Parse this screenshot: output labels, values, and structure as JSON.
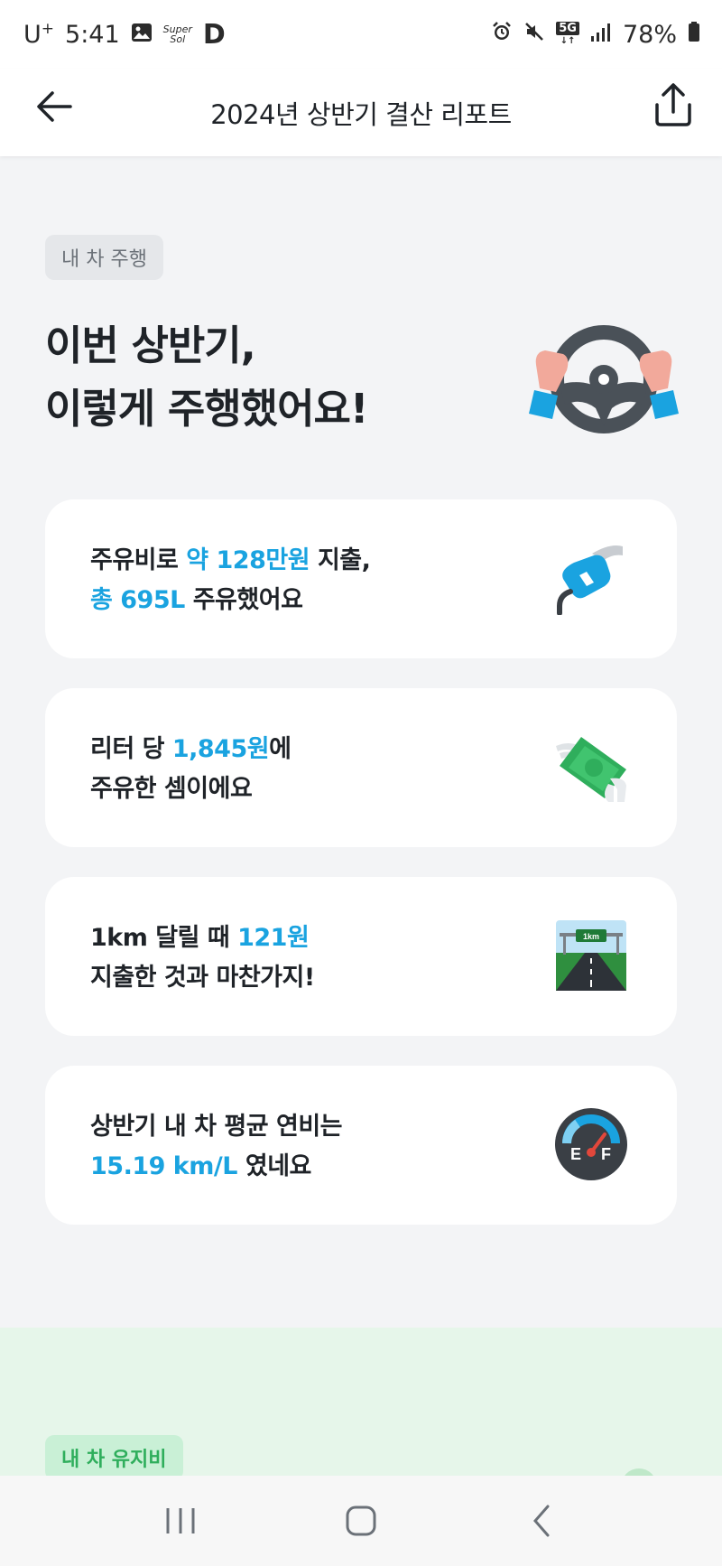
{
  "status_bar": {
    "carrier": "U",
    "carrier_sup": "+",
    "time": "5:41",
    "app_badge_top": "Super",
    "app_badge_bottom": "Sol",
    "app_letter": "D",
    "network": "5G",
    "battery": "78%"
  },
  "header": {
    "title": "2024년 상반기 결산 리포트"
  },
  "section1": {
    "chip": "내 차 주행",
    "title_line1": "이번 상반기,",
    "title_line2": "이렇게 주행했어요!"
  },
  "cards": [
    {
      "line1_pre": "주유비로 ",
      "line1_accent": "약 128만원",
      "line1_post": " 지출,",
      "line2_accent": "총 695L",
      "line2_post": " 주유했어요",
      "icon": "fuel-nozzle-icon"
    },
    {
      "line1_pre": "리터 당 ",
      "line1_accent": "1,845원",
      "line1_post": "에",
      "line2": "주유한 셈이에요",
      "icon": "flying-money-icon"
    },
    {
      "line1_pre": "1km 달릴 때 ",
      "line1_accent": "121원",
      "line2": "지출한 것과 마찬가지!",
      "icon": "highway-sign-icon",
      "sign_text": "1km"
    },
    {
      "line1": "상반기 내 차 평균 연비는",
      "line2_accent": "15.19 km/L",
      "line2_post": " 였네요",
      "icon": "fuel-gauge-icon",
      "gauge_e": "E",
      "gauge_f": "F"
    }
  ],
  "section2": {
    "chip": "내 차 유지비"
  },
  "colors": {
    "accent": "#1aa3e0",
    "background": "#f3f4f6",
    "card": "#ffffff",
    "green_section": "#e6f6ea",
    "green_chip_text": "#2fae5c"
  }
}
